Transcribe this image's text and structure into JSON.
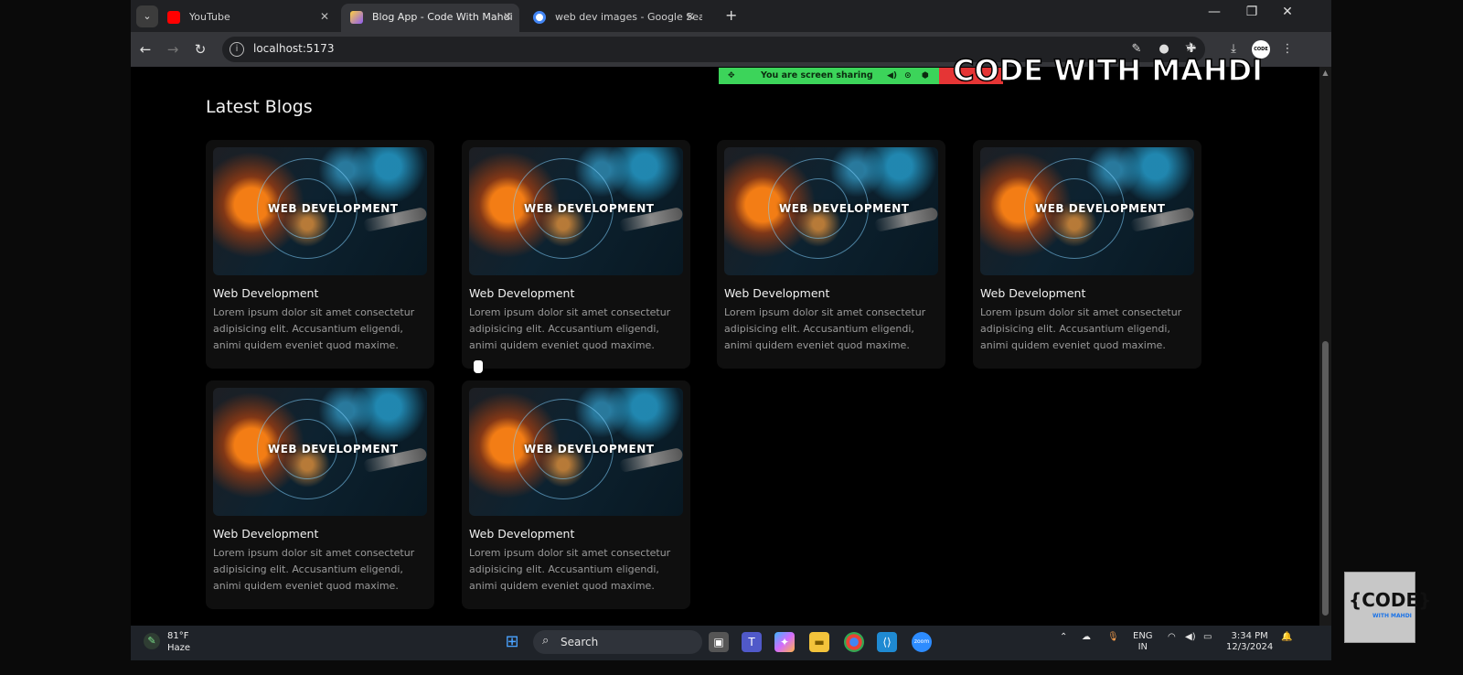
{
  "browser": {
    "tabs": [
      {
        "label": "YouTube",
        "active": false,
        "favicon_color": "#ff0000"
      },
      {
        "label": "Blog App - Code With Mahdi",
        "active": true,
        "favicon_color": "#8e5cf7"
      },
      {
        "label": "web dev images - Google Searc",
        "active": false,
        "favicon_color": "#4285f4"
      }
    ],
    "url": "localhost:5173",
    "profile_label": "CODE"
  },
  "page": {
    "heading": "Latest Blogs",
    "cards": [
      {
        "image_text": "WEB DEVELOPMENT",
        "title": "Web Development",
        "description": "Lorem ipsum dolor sit amet consectetur adipisicing elit. Accusantium eligendi, animi quidem eveniet quod maxime."
      },
      {
        "image_text": "WEB DEVELOPMENT",
        "title": "Web Development",
        "description": "Lorem ipsum dolor sit amet consectetur adipisicing elit. Accusantium eligendi, animi quidem eveniet quod maxime."
      },
      {
        "image_text": "WEB DEVELOPMENT",
        "title": "Web Development",
        "description": "Lorem ipsum dolor sit amet consectetur adipisicing elit. Accusantium eligendi, animi quidem eveniet quod maxime."
      },
      {
        "image_text": "WEB DEVELOPMENT",
        "title": "Web Development",
        "description": "Lorem ipsum dolor sit amet consectetur adipisicing elit. Accusantium eligendi, animi quidem eveniet quod maxime."
      },
      {
        "image_text": "WEB DEVELOPMENT",
        "title": "Web Development",
        "description": "Lorem ipsum dolor sit amet consectetur adipisicing elit. Accusantium eligendi, animi quidem eveniet quod maxime."
      },
      {
        "image_text": "WEB DEVELOPMENT",
        "title": "Web Development",
        "description": "Lorem ipsum dolor sit amet consectetur adipisicing elit. Accusantium eligendi, animi quidem eveniet quod maxime."
      }
    ]
  },
  "overlay": {
    "share_text": "You are screen sharing",
    "watermark": "CODE WITH MAHDI",
    "logo_main": "{CODE}",
    "logo_sub": "WITH MAHDI"
  },
  "taskbar": {
    "temp": "81°F",
    "weather": "Haze",
    "search_label": "Search",
    "lang_top": "ENG",
    "lang_bottom": "IN",
    "time": "3:34 PM",
    "date": "12/3/2024"
  },
  "colors": {
    "share_green": "#3cd45a",
    "stop_red": "#e53535",
    "card_bg": "#0f0f0f"
  }
}
